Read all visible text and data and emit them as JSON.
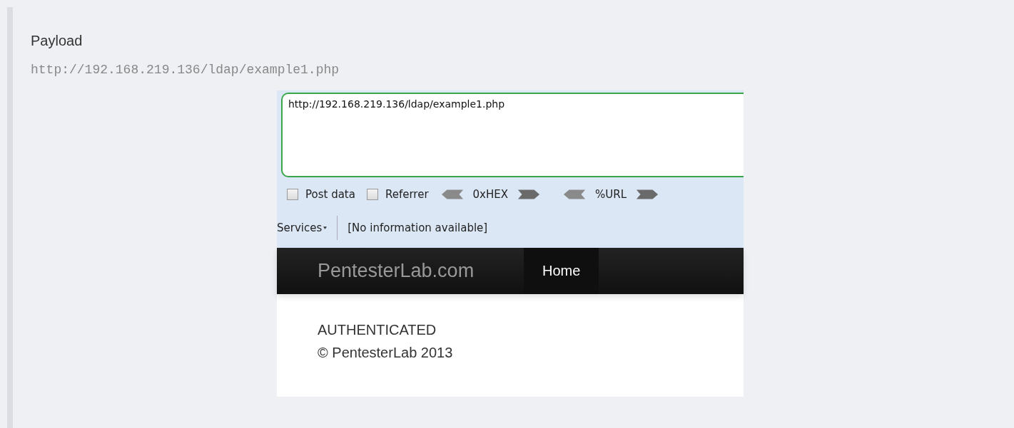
{
  "heading": "Payload",
  "code": "http://192.168.219.136/ldap/example1.php",
  "screenshot": {
    "url_box": {
      "value": "http://192.168.219.136/ldap/example1.php"
    },
    "options": [
      {
        "kind": "checkbox",
        "label": "Post data",
        "checked": false
      },
      {
        "kind": "checkbox",
        "label": "Referrer",
        "checked": false
      },
      {
        "kind": "encoder",
        "label": "0xHEX"
      },
      {
        "kind": "encoder",
        "label": "%URL"
      }
    ],
    "services": "Services",
    "info": "[No information available]",
    "brand": "PentesterLab.com",
    "nav": [
      {
        "label": "Home",
        "selected": true
      }
    ],
    "lines": [
      "AUTHENTICATED",
      "© PentesterLab 2013"
    ]
  }
}
